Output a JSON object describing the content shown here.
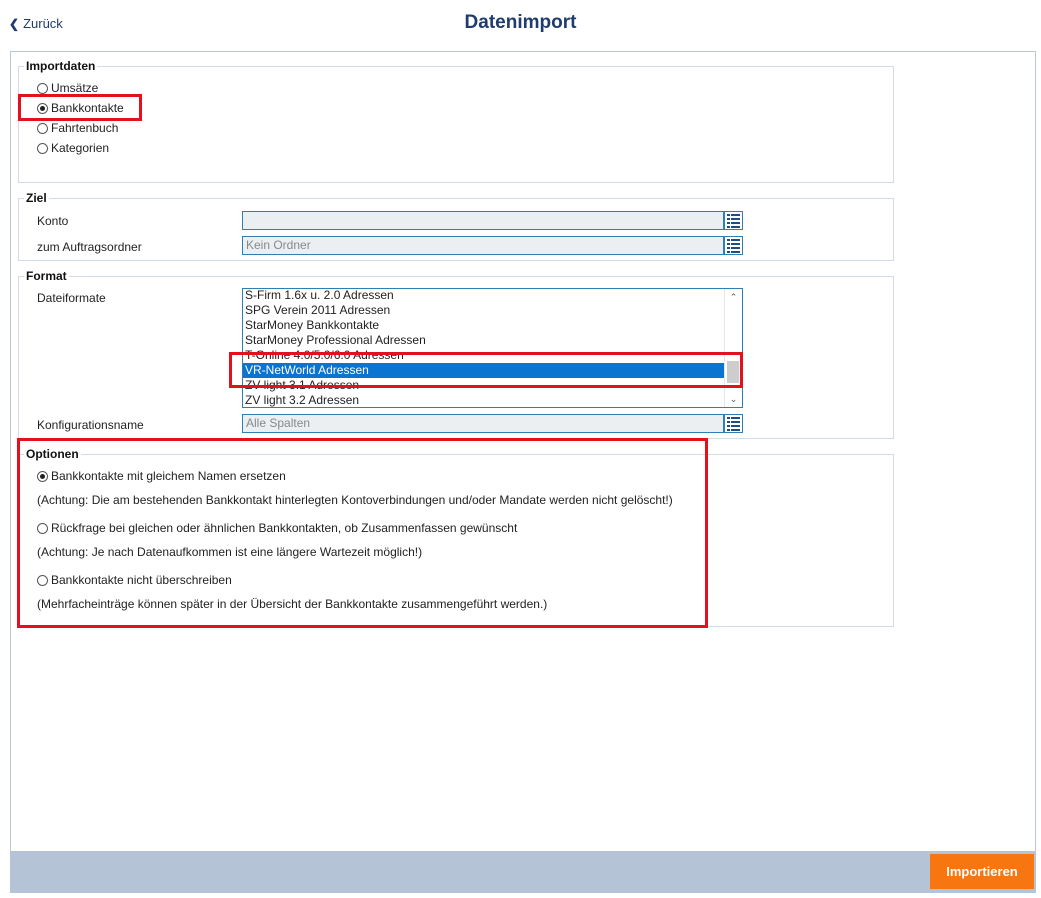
{
  "header": {
    "back_label": "Zurück",
    "title": "Datenimport"
  },
  "importdaten": {
    "legend": "Importdaten",
    "options": [
      {
        "label": "Umsätze",
        "selected": false
      },
      {
        "label": "Bankkontakte",
        "selected": true
      },
      {
        "label": "Fahrtenbuch",
        "selected": false
      },
      {
        "label": "Kategorien",
        "selected": false
      }
    ]
  },
  "ziel": {
    "legend": "Ziel",
    "konto_label": "Konto",
    "konto_value": "",
    "ordner_label": "zum Auftragsordner",
    "ordner_placeholder": "Kein Ordner"
  },
  "format": {
    "legend": "Format",
    "dateiformate_label": "Dateiformate",
    "items": [
      "S-Firm 1.6x u. 2.0 Adressen",
      "SPG Verein 2011 Adressen",
      "StarMoney Bankkontakte",
      "StarMoney Professional Adressen",
      "T-Online 4.0/5.0/6.0 Adressen",
      "VR-NetWorld Adressen",
      "ZV light 3.1 Adressen",
      "ZV light 3.2 Adressen"
    ],
    "selected_index": 5,
    "konfig_label": "Konfigurationsname",
    "konfig_placeholder": "Alle Spalten"
  },
  "optionen": {
    "legend": "Optionen",
    "items": [
      {
        "label": "Bankkontakte mit gleichem Namen ersetzen",
        "note": "(Achtung: Die am bestehenden Bankkontakt hinterlegten Kontoverbindungen und/oder Mandate werden nicht gelöscht!)",
        "selected": true
      },
      {
        "label": "Rückfrage bei gleichen oder ähnlichen Bankkontakten, ob Zusammenfassen gewünscht",
        "note": "(Achtung: Je nach Datenaufkommen ist eine längere Wartezeit möglich!)",
        "selected": false
      },
      {
        "label": "Bankkontakte nicht überschreiben",
        "note": "(Mehrfacheinträge können später in der Übersicht der Bankkontakte zusammengeführt werden.)",
        "selected": false
      }
    ]
  },
  "footer": {
    "import_label": "Importieren"
  },
  "colors": {
    "accent": "#f7760f",
    "title": "#1f3c6e",
    "highlight": "#e3111b",
    "selection": "#0a74d0"
  }
}
